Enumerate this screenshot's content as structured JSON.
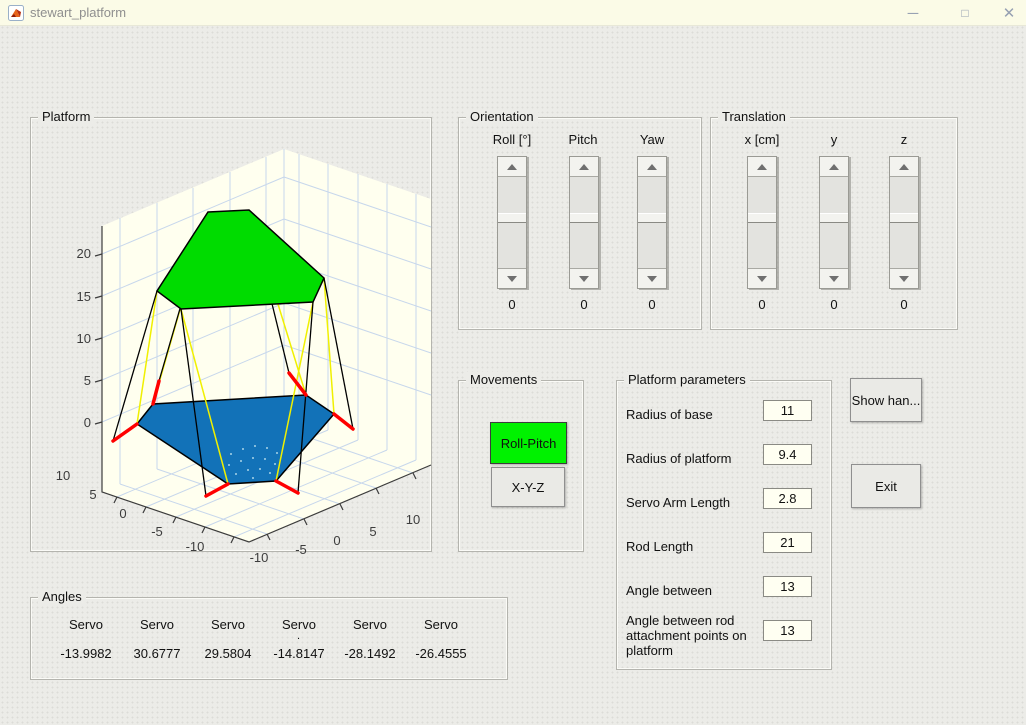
{
  "window": {
    "title": "stewart_platform",
    "icons": {
      "minimize": "─",
      "maximize": "□",
      "close": "✕"
    }
  },
  "platform_panel": {
    "title": "Platform",
    "axes": {
      "z": [
        20,
        15,
        10,
        5,
        0
      ],
      "y": [
        10,
        5,
        0,
        -5,
        -10
      ],
      "x": [
        -10,
        -5,
        0,
        5,
        10
      ]
    },
    "colors": {
      "platform_top": "#00DC00",
      "base": "#1272B8",
      "rod": "#000000",
      "servo_arm": "#FF0000",
      "leg_line": "#F0F000",
      "grid": "#C7D7EC",
      "wall": "#FFFFEF"
    }
  },
  "orientation": {
    "title": "Orientation",
    "sliders": [
      {
        "label": "Roll [°]",
        "value": "0"
      },
      {
        "label": "Pitch",
        "value": "0"
      },
      {
        "label": "Yaw",
        "value": "0"
      }
    ]
  },
  "translation": {
    "title": "Translation",
    "sliders": [
      {
        "label": "x [cm]",
        "value": "0"
      },
      {
        "label": "y",
        "value": "0"
      },
      {
        "label": "z",
        "value": "0"
      }
    ]
  },
  "movements": {
    "title": "Movements",
    "buttons": [
      {
        "label": "Roll-Pitch",
        "color": "#00F200"
      },
      {
        "label": "X-Y-Z",
        "color": "#EAEAE6"
      }
    ]
  },
  "parameters": {
    "title": "Platform parameters",
    "fields": [
      {
        "label": "Radius of base",
        "value": "11"
      },
      {
        "label": "Radius of platform",
        "value": "9.4"
      },
      {
        "label": "Servo Arm Length",
        "value": "2.8"
      },
      {
        "label": "Rod Length",
        "value": "21"
      },
      {
        "label": "Angle between",
        "value": "13"
      },
      {
        "label": "Angle between rod attachment points on platform",
        "value": "13"
      }
    ]
  },
  "actions": {
    "show_handles": "Show han...",
    "exit": "Exit"
  },
  "angles": {
    "title": "Angles",
    "dot": ".",
    "servos": [
      {
        "label": "Servo",
        "value": "-13.9982"
      },
      {
        "label": "Servo",
        "value": "30.6777"
      },
      {
        "label": "Servo",
        "value": "29.5804"
      },
      {
        "label": "Servo",
        "value": "-14.8147"
      },
      {
        "label": "Servo",
        "value": "-28.1492"
      },
      {
        "label": "Servo",
        "value": "-26.4555"
      }
    ]
  }
}
